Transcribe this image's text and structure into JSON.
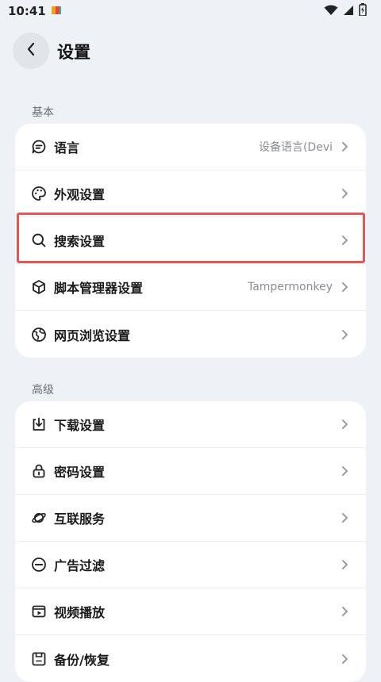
{
  "status_bar": {
    "time": "10:41"
  },
  "header": {
    "title": "设置"
  },
  "sections": [
    {
      "label": "基本",
      "items": [
        {
          "label": "语言",
          "value": "设备语言(Devi",
          "icon": "chat-bubble-icon"
        },
        {
          "label": "外观设置",
          "value": "",
          "icon": "palette-icon"
        },
        {
          "label": "搜索设置",
          "value": "",
          "icon": "search-icon"
        },
        {
          "label": "脚本管理器设置",
          "value": "Tampermonkey",
          "icon": "cube-icon"
        },
        {
          "label": "网页浏览设置",
          "value": "",
          "icon": "globe-icon"
        }
      ]
    },
    {
      "label": "高级",
      "items": [
        {
          "label": "下载设置",
          "value": "",
          "icon": "download-icon"
        },
        {
          "label": "密码设置",
          "value": "",
          "icon": "lock-icon"
        },
        {
          "label": "互联服务",
          "value": "",
          "icon": "planet-icon"
        },
        {
          "label": "广告过滤",
          "value": "",
          "icon": "block-icon"
        },
        {
          "label": "视频播放",
          "value": "",
          "icon": "video-icon"
        },
        {
          "label": "备份/恢复",
          "value": "",
          "icon": "save-icon"
        }
      ]
    }
  ],
  "colors": {
    "background": "#eef1f5",
    "card": "#ffffff",
    "highlight": "#e95555",
    "secondary_text": "#8a8d92"
  }
}
